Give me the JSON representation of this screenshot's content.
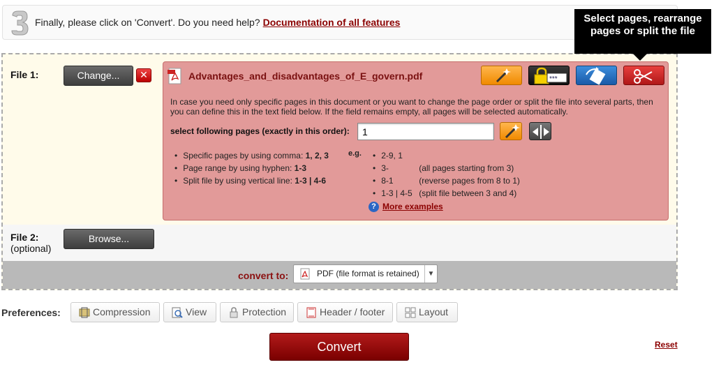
{
  "step": {
    "number": "3",
    "text": "Finally, please click on 'Convert'. Do you need help?",
    "link": "Documentation of all features"
  },
  "tooltip": "Select pages, rearrange pages or split the file",
  "file1": {
    "label": "File 1:",
    "change_label": "Change...",
    "remove_label": "✕",
    "filename": "Advantages_and_disadvantages_of_E_govern.pdf",
    "info": "In case you need only specific pages in this document or you want to change the page order or split the file into several parts, then you can define this in the text field below. If the field remains empty, all pages will be selected automatically.",
    "select_label": "select following pages (exactly in this order):",
    "pages_value": "1",
    "tools": [
      "wand-icon",
      "lock-icon",
      "rotate-icon",
      "scissors-icon"
    ],
    "help": [
      {
        "text": "Specific pages by using comma: ",
        "bold": "1, 2, 3"
      },
      {
        "text": "Page range by using hyphen: ",
        "bold": "1-3"
      },
      {
        "text": "Split file by using vertical line: ",
        "bold": "1-3 | 4-6"
      }
    ],
    "eg_label": "e.g.",
    "examples": [
      {
        "value": "2-9, 1",
        "note": ""
      },
      {
        "value": "3-",
        "note": "(all pages starting from 3)"
      },
      {
        "value": "8-1",
        "note": "(reverse pages from 8 to 1)"
      },
      {
        "value": "1-3 | 4-5",
        "note": "(split file between 3 and 4)"
      }
    ],
    "more_examples": "More examples"
  },
  "file2": {
    "label": "File 2:",
    "optional": "(optional)",
    "browse_label": "Browse..."
  },
  "convert_to": {
    "label": "convert to:",
    "selected": "PDF (file format is retained)"
  },
  "preferences": {
    "label": "Preferences:",
    "items": [
      "Compression",
      "View",
      "Protection",
      "Header / footer",
      "Layout"
    ]
  },
  "convert_label": "Convert",
  "reset_label": "Reset",
  "colors": {
    "accent": "#8b0000",
    "file_box": "#e29a99",
    "panel_bg": "#fffbea"
  }
}
